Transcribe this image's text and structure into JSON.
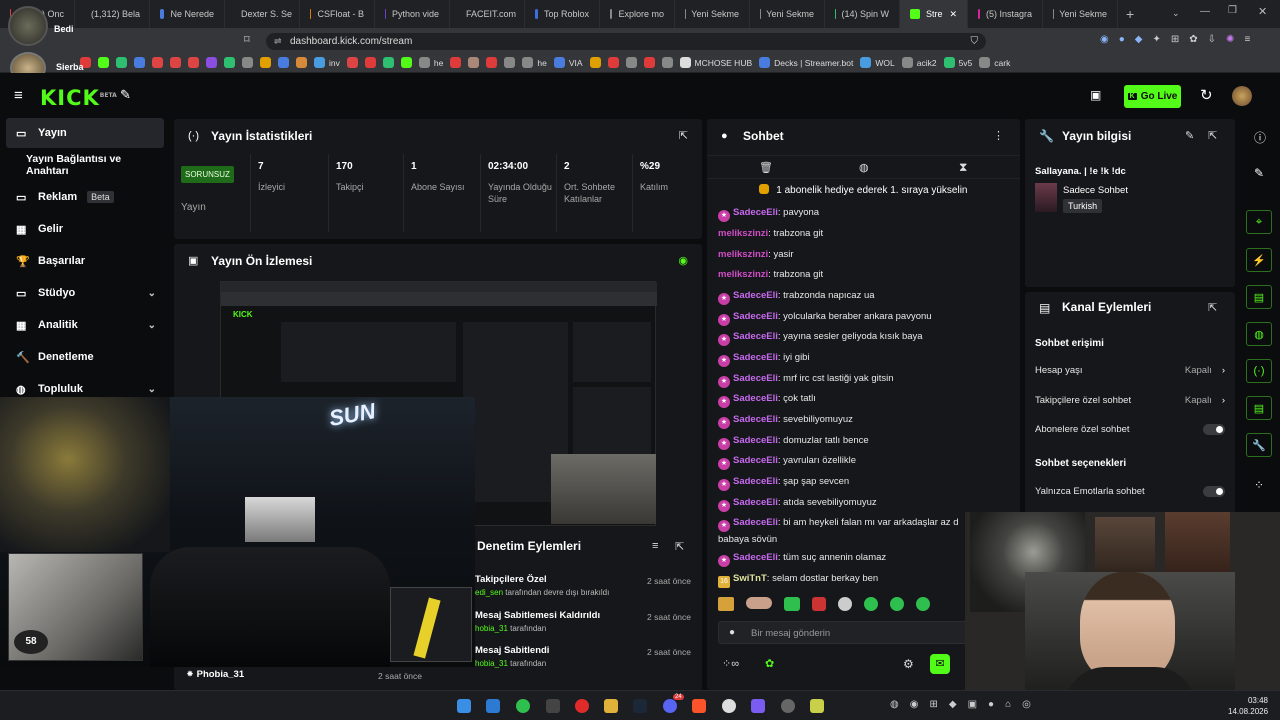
{
  "tabs": [
    {
      "label": "(1,312) Onc",
      "color": "#e03b3b"
    },
    {
      "label": "(1,312) Bela",
      "color": "#e0246a"
    },
    {
      "label": "Ne Nerede",
      "color": "#4a7ce0"
    },
    {
      "label": "Dexter S. Se",
      "color": "#cc2222"
    },
    {
      "label": "CSFloat - B",
      "color": "#e07b00"
    },
    {
      "label": "Python vide",
      "color": "#6b3ec8"
    },
    {
      "label": "FACEIT.com",
      "color": "#ff5500"
    },
    {
      "label": "Top Roblox",
      "color": "#3b6ee0"
    },
    {
      "label": "Explore mo",
      "color": "#888888"
    },
    {
      "label": "Yeni Sekme",
      "color": "#888888"
    },
    {
      "label": "Yeni Sekme",
      "color": "#888888"
    },
    {
      "label": "(14) Spin W",
      "color": "#2fbf71"
    },
    {
      "label": "Stre",
      "color": "#53fc18",
      "active": true
    },
    {
      "label": "(5) Instagra",
      "color": "#d6249f"
    },
    {
      "label": "Yeni Sekme",
      "color": "#888888"
    }
  ],
  "address": {
    "url": "dashboard.kick.com/stream"
  },
  "profile": {
    "name1": "Bedi",
    "name2": "Sierba"
  },
  "bookmarks": [
    {
      "label": "",
      "color": "#e03b3b"
    },
    {
      "label": "",
      "color": "#53fc18"
    },
    {
      "label": "",
      "color": "#2fbf71"
    },
    {
      "label": "",
      "color": "#4a7ce0"
    },
    {
      "label": "",
      "color": "#d44"
    },
    {
      "label": "",
      "color": "#d44"
    },
    {
      "label": "",
      "color": "#d44"
    },
    {
      "label": "",
      "color": "#8a4ee0"
    },
    {
      "label": "",
      "color": "#2fbf71"
    },
    {
      "label": "",
      "color": "#888"
    },
    {
      "label": "",
      "color": "#e0a000"
    },
    {
      "label": "",
      "color": "#4a7ce0"
    },
    {
      "label": "",
      "color": "#d68a3a"
    },
    {
      "label": "inv",
      "color": "#4a9ce0"
    },
    {
      "label": "",
      "color": "#d44"
    },
    {
      "label": "",
      "color": "#e03b3b"
    },
    {
      "label": "",
      "color": "#2fbf71"
    },
    {
      "label": "",
      "color": "#53fc18"
    },
    {
      "label": "he",
      "color": "#888"
    },
    {
      "label": "",
      "color": "#e03b3b"
    },
    {
      "label": "",
      "color": "#a87"
    },
    {
      "label": "",
      "color": "#e03b3b"
    },
    {
      "label": "",
      "color": "#888"
    },
    {
      "label": "he",
      "color": "#888"
    },
    {
      "label": "VIA",
      "color": "#4a7ce0"
    },
    {
      "label": "",
      "color": "#e0a000"
    },
    {
      "label": "",
      "color": "#e03b3b"
    },
    {
      "label": "",
      "color": "#888"
    },
    {
      "label": "",
      "color": "#e03b3b"
    },
    {
      "label": "",
      "color": "#888"
    },
    {
      "label": "MCHOSE HUB",
      "color": "#ddd"
    },
    {
      "label": "Decks | Streamer.bot",
      "color": "#4a7ce0"
    },
    {
      "label": "WOL",
      "color": "#4a9ce0"
    },
    {
      "label": "acik2",
      "color": "#888"
    },
    {
      "label": "5v5",
      "color": "#2fbf71"
    },
    {
      "label": "cark",
      "color": "#888"
    }
  ],
  "header": {
    "logo": "KICK",
    "beta": "BETA",
    "go_live": "Go Live",
    "accent": "#53fc18"
  },
  "sidebar": {
    "items": [
      {
        "label": "Yayın",
        "active": true
      },
      {
        "label": "Yayın Bağlantısı ve Anahtarı"
      },
      {
        "label": "Reklam",
        "badge": "Beta"
      },
      {
        "label": "Gelir"
      },
      {
        "label": "Başarılar"
      },
      {
        "label": "Stüdyo",
        "chevron": true
      },
      {
        "label": "Analitik",
        "chevron": true
      },
      {
        "label": "Denetleme"
      },
      {
        "label": "Topluluk",
        "chevron": true
      }
    ]
  },
  "stats": {
    "title": "Yayın İstatistikleri",
    "status_badge": "SORUNSUZ",
    "status_label": "Yayın",
    "items": [
      {
        "value": "7",
        "label": "İzleyici"
      },
      {
        "value": "170",
        "label": "Takipçi"
      },
      {
        "value": "1",
        "label": "Abone Sayısı"
      },
      {
        "value": "02:34:00",
        "label": "Yayında Olduğu Süre"
      },
      {
        "value": "2",
        "label": "Ort. Sohbete Katılanlar"
      },
      {
        "value": "%29",
        "label": "Katılım"
      }
    ]
  },
  "preview": {
    "title": "Yayın Ön İzlemesi",
    "overlay_text": "SUN",
    "fps": "58"
  },
  "mod_actions": {
    "title": "Denetim Eylemleri",
    "items": [
      {
        "title": "Takipçilere Özel",
        "user": "edi_sen",
        "suffix": "tarafından devre dışı bırakıldı",
        "time": "2 saat önce"
      },
      {
        "title": "Mesaj Sabitlemesi Kaldırıldı",
        "user": "hobia_31",
        "suffix": "tarafından",
        "time": "2 saat önce"
      },
      {
        "title": "Mesaj Sabitlendi",
        "user": "hobia_31",
        "suffix": "tarafından",
        "time": "2 saat önce"
      },
      {
        "title": "Phobia_31",
        "user": "",
        "suffix": "",
        "time": "2 saat önce"
      }
    ]
  },
  "chat": {
    "title": "Sohbet",
    "pinned": "1 abonelik hediye ederek 1. sıraya yükselin",
    "placeholder": "Bir mesaj gönderin",
    "messages": [
      {
        "user": "SadeceEli",
        "text": "pavyona",
        "badge": true
      },
      {
        "user": "melikszinzi",
        "text": "trabzona git"
      },
      {
        "user": "melikszinzi",
        "text": "yasir"
      },
      {
        "user": "melikszinzi",
        "text": "trabzona git"
      },
      {
        "user": "SadeceEli",
        "text": "trabzonda napıcaz ua",
        "badge": true
      },
      {
        "user": "SadeceEli",
        "text": "yolcularka beraber ankara pavyonu",
        "badge": true
      },
      {
        "user": "SadeceEli",
        "text": "yayına sesler geliyoda kısık baya",
        "badge": true
      },
      {
        "user": "SadeceEli",
        "text": "iyi gibi",
        "badge": true
      },
      {
        "user": "SadeceEli",
        "text": "mrf irc cst lastiği yak gitsin",
        "badge": true
      },
      {
        "user": "SadeceEli",
        "text": "çok tatlı",
        "badge": true
      },
      {
        "user": "SadeceEli",
        "text": "sevebiliyomuyuz",
        "badge": true
      },
      {
        "user": "SadeceEli",
        "text": "domuzlar tatlı bence",
        "badge": true
      },
      {
        "user": "SadeceEli",
        "text": "yavruları özellikle",
        "badge": true
      },
      {
        "user": "SadeceEli",
        "text": "şap şap sevcen",
        "badge": true
      },
      {
        "user": "SadeceEli",
        "text": "atıda sevebiliyomuyuz",
        "badge": true
      },
      {
        "user": "SadeceEli",
        "text": "bi am heykeli falan mı var arkadaşlar az d",
        "badge": true,
        "cont": "babaya sövün"
      },
      {
        "user": "SadeceEli",
        "text": "tüm suç annenin olamaz",
        "badge": true
      },
      {
        "user": "SwiTnT",
        "text": "selam dostlar berkay ben",
        "badge16": "16"
      }
    ]
  },
  "stream_info": {
    "title": "Yayın bilgisi",
    "stream_title": "Sallayana. | !e !k !dc",
    "category": "Sadece Sohbet",
    "language": "Turkish"
  },
  "channel_actions": {
    "title": "Kanal Eylemleri",
    "chat_access_title": "Sohbet erişimi",
    "account_age": {
      "label": "Hesap yaşı",
      "value": "Kapalı"
    },
    "followers_only": {
      "label": "Takipçilere özel sohbet",
      "value": "Kapalı"
    },
    "subs_only": {
      "label": "Abonelere özel sohbet"
    },
    "chat_options_title": "Sohbet seçenekleri",
    "emote_only": {
      "label": "Yalnızca Emotlarla sohbet"
    }
  },
  "taskbar": {
    "time": "03:48",
    "date": "14.08.2026",
    "badge": "24"
  }
}
